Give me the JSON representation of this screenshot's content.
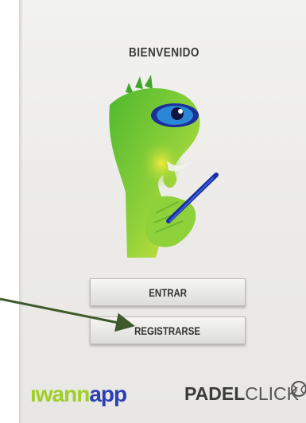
{
  "screen": {
    "title": "BIENVENIDO"
  },
  "buttons": {
    "login_label": "ENTRAR",
    "register_label": "REGISTRARSE"
  },
  "footer": {
    "brand_left_part1": "IWANN",
    "brand_left_display_part1": "ıwann",
    "brand_left_display_part2": "app",
    "brand_right_bold": "PADEL",
    "brand_right_light": "CLICK"
  },
  "icons": {
    "mascot": "mascot-illustration",
    "annotation": "arrow-icon",
    "padel_ball": "padel-ball-icon"
  },
  "colors": {
    "brand_green": "#9fcf27",
    "brand_blue": "#2a3fb3",
    "arrow": "#3e5a2b"
  }
}
